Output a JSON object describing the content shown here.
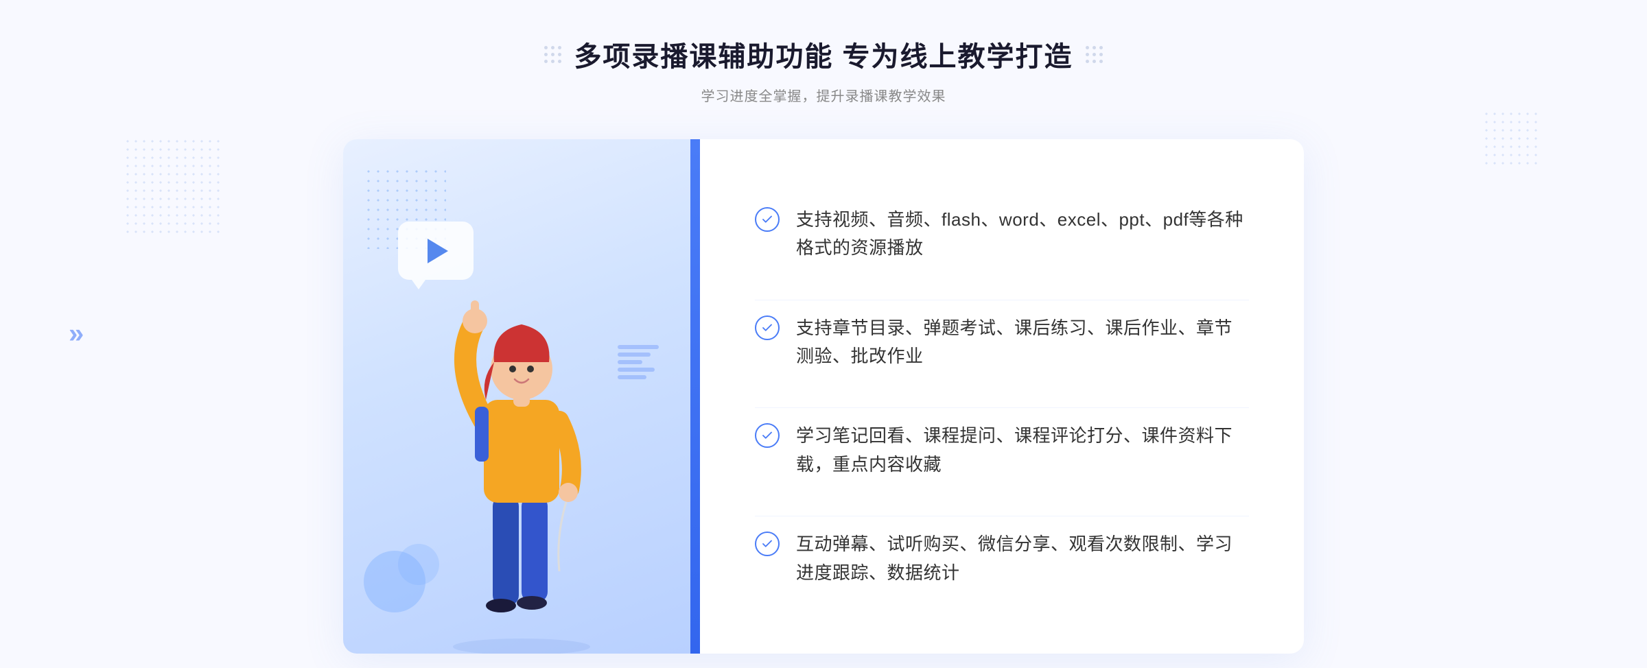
{
  "header": {
    "title": "多项录播课辅助功能 专为线上教学打造",
    "subtitle": "学习进度全掌握，提升录播课教学效果"
  },
  "decorative": {
    "chevron": "»"
  },
  "features": [
    {
      "id": 1,
      "text": "支持视频、音频、flash、word、excel、ppt、pdf等各种格式的资源播放"
    },
    {
      "id": 2,
      "text": "支持章节目录、弹题考试、课后练习、课后作业、章节测验、批改作业"
    },
    {
      "id": 3,
      "text": "学习笔记回看、课程提问、课程评论打分、课件资料下载，重点内容收藏"
    },
    {
      "id": 4,
      "text": "互动弹幕、试听购买、微信分享、观看次数限制、学习进度跟踪、数据统计"
    }
  ]
}
